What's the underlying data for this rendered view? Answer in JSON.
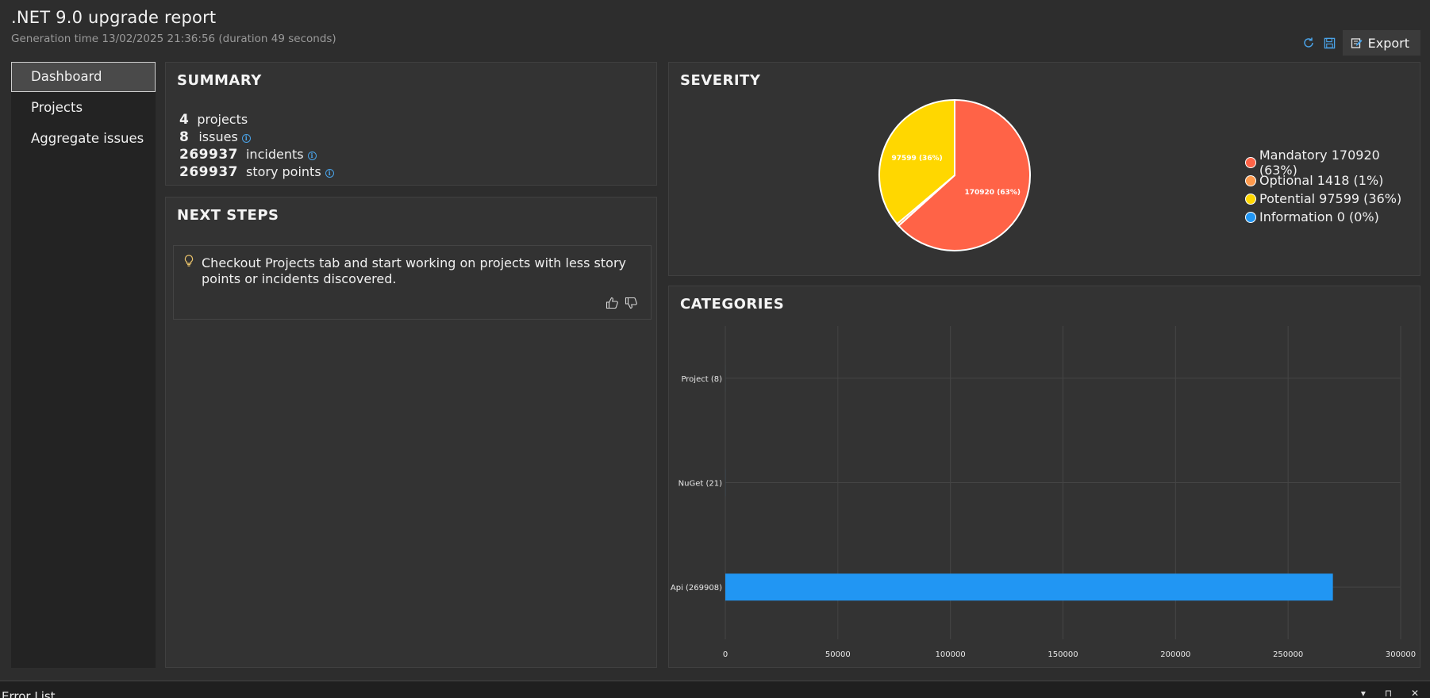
{
  "header": {
    "title": ".NET 9.0 upgrade report",
    "subtitle": "Generation time 13/02/2025 21:36:56 (duration 49 seconds)"
  },
  "toolbar": {
    "refresh_icon": "refresh-icon",
    "save_icon": "save-icon",
    "export_label": "Export"
  },
  "sidebar": {
    "items": [
      {
        "label": "Dashboard",
        "active": true
      },
      {
        "label": "Projects",
        "active": false
      },
      {
        "label": "Aggregate issues",
        "active": false
      }
    ]
  },
  "summary": {
    "title": "SUMMARY",
    "rows": [
      {
        "value": "4",
        "label": "projects"
      },
      {
        "value": "8",
        "label": "issues"
      },
      {
        "value": "269937",
        "label": "incidents"
      },
      {
        "value": "269937",
        "label": "story points"
      }
    ]
  },
  "next_steps": {
    "title": "NEXT STEPS",
    "text": "Checkout Projects tab and start working on projects with less story points or incidents discovered."
  },
  "severity": {
    "title": "SEVERITY",
    "legend": [
      {
        "label": "Mandatory 170920 (63%)",
        "color": "#ff6347"
      },
      {
        "label": "Optional 1418 (1%)",
        "color": "#ff9a4d"
      },
      {
        "label": "Potential 97599 (36%)",
        "color": "#ffd700"
      },
      {
        "label": "Information 0 (0%)",
        "color": "#2196f3"
      }
    ]
  },
  "categories": {
    "title": "CATEGORIES"
  },
  "chart_data": [
    {
      "type": "pie",
      "labels": [
        "Mandatory",
        "Optional",
        "Potential",
        "Information"
      ],
      "values": [
        170920,
        1418,
        97599,
        0
      ],
      "slice_labels": [
        "170920 (63%)",
        "",
        "97599 (36%)",
        ""
      ],
      "colors": [
        "#ff6347",
        "#ff9a4d",
        "#ffd700",
        "#2196f3"
      ],
      "legend": "right"
    },
    {
      "type": "bar",
      "orientation": "horizontal",
      "categories": [
        "Project (8)",
        "NuGet (21)",
        "Api (269908)"
      ],
      "values": [
        8,
        21,
        269908
      ],
      "xlim": [
        0,
        300000
      ],
      "xticks": [
        "0",
        "50000",
        "100000",
        "150000",
        "200000",
        "250000",
        "300000"
      ],
      "color": "#2196f3",
      "grid": true
    }
  ],
  "bottom": {
    "label": "Error List",
    "controls": "▾ ⊓ ✕"
  }
}
